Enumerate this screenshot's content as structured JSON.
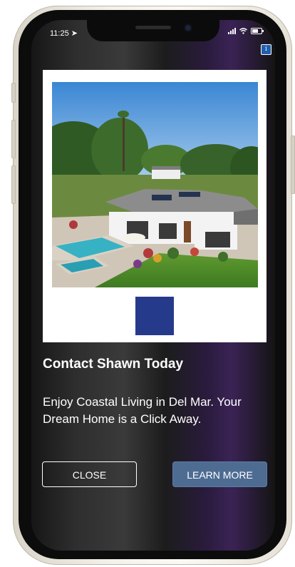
{
  "status_bar": {
    "time": "11:25",
    "location_icon": "location-arrow-icon",
    "wifi_icon": "wifi-icon",
    "battery_icon": "battery-icon"
  },
  "info_icon": "info-icon",
  "card": {
    "image": "aerial-photo-of-coastal-house-with-pool",
    "swatch_color": "#263a8c"
  },
  "headline": "Contact Shawn Today",
  "body": "Enjoy Coastal Living in Del Mar. Your Dream Home is a Click Away.",
  "buttons": {
    "close_label": "CLOSE",
    "learn_more_label": "LEARN MORE"
  },
  "colors": {
    "accent_button": "#4e6c92",
    "swatch": "#263a8c"
  }
}
